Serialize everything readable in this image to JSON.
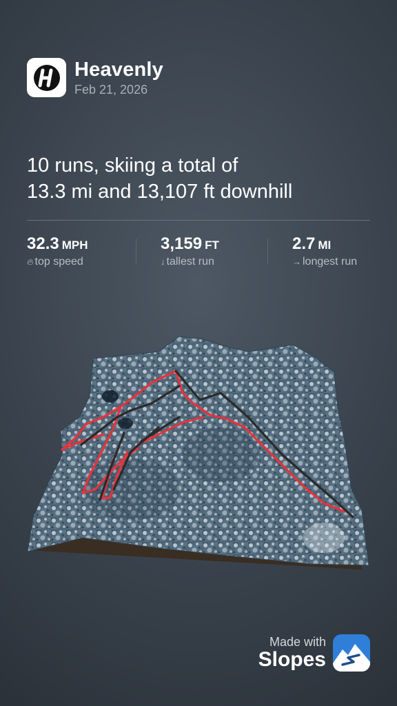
{
  "resort": {
    "name": "Heavenly",
    "date": "Feb 21, 2026",
    "logo_icon": "heavenly-h-logo"
  },
  "summary": {
    "line1": "10 runs, skiing a total of",
    "line2": "13.3 mi and 13,107 ft downhill"
  },
  "stats": [
    {
      "value": "32.3",
      "unit": "MPH",
      "icon": "flame",
      "label": "top speed"
    },
    {
      "value": "3,159",
      "unit": "FT",
      "icon": "arrow-down",
      "label": "tallest run"
    },
    {
      "value": "2.7",
      "unit": "MI",
      "icon": "arrow-right",
      "label": "longest run"
    }
  ],
  "footer": {
    "made_with": "Made with",
    "app": "Slopes",
    "app_icon": "slopes-logo"
  },
  "colors": {
    "run_track": "#e8323a",
    "lift_track": "#2f2f2f",
    "accent_blue": "#2f7fd8"
  }
}
